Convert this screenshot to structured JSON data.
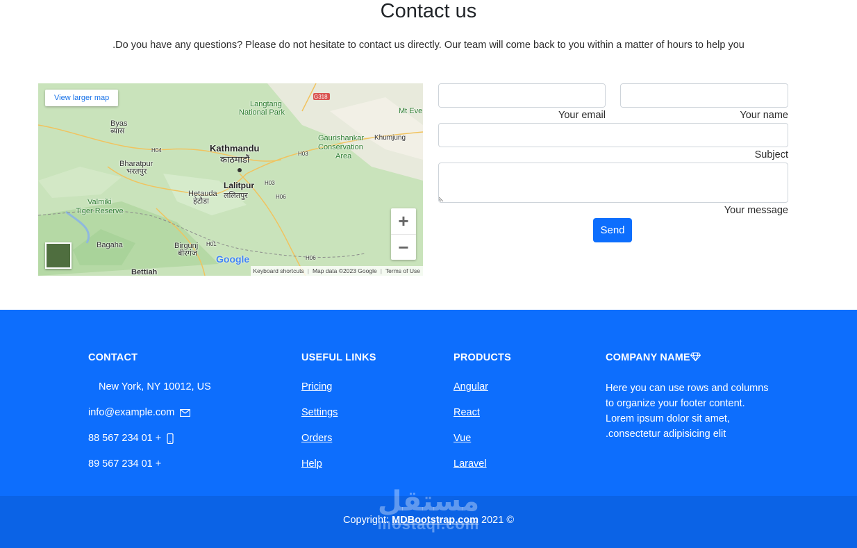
{
  "header": {
    "title": "Contact us",
    "subtitle": ".Do you have any questions? Please do not hesitate to contact us directly. Our team will come back to you within a matter of hours to help you"
  },
  "map": {
    "view_larger_label": "View larger map",
    "labels": {
      "kathmandu": "Kathmandu",
      "kathmandu_ne": "काठमाडौं",
      "lalitpur": "Lalitpur",
      "lalitpur_ne": "ललितपुर",
      "langtang": "Langtang",
      "national_park": "National Park",
      "gaurishankar": "Gaurishankar",
      "conservation": "Conservation",
      "area": "Area",
      "byas": "Byas",
      "byas_ne": "ब्यास",
      "bharatpur": "Bharatpur",
      "bharatpur_ne": "भरतपुर",
      "hetauda": "Hetauda",
      "hetauda_ne": "हेटौडा",
      "valmiki": "Valmiki",
      "tiger_reserve": "Tiger Reserve",
      "bagaha": "Bagaha",
      "birgunj": "Birgunj",
      "birgunj_ne": "बीरगंज",
      "bettiah": "Bettiah",
      "khumjung": "Khumjung",
      "mt_everest": "Mt Eve",
      "g318": "G318",
      "h04": "H04",
      "h03": "H03",
      "h03b": "H03",
      "h06": "H06",
      "h01": "H01",
      "h06b": "H06"
    },
    "zoom_in": "+",
    "zoom_out": "−",
    "google": "Google",
    "attribution": [
      "Keyboard shortcuts",
      "Map data ©2023 Google",
      "Terms of Use"
    ]
  },
  "form": {
    "email_label": "Your email",
    "name_label": "Your name",
    "subject_label": "Subject",
    "message_label": "Your message",
    "send_label": "Send"
  },
  "footer": {
    "contact": {
      "heading": "CONTACT",
      "address": "New York, NY 10012, US",
      "email": "info@example.com",
      "phone1": "88 567 234 01 +",
      "phone2": "89 567 234 01 +"
    },
    "useful_links": {
      "heading": "USEFUL LINKS",
      "items": [
        "Pricing",
        "Settings",
        "Orders",
        "Help"
      ]
    },
    "products": {
      "heading": "PRODUCTS",
      "items": [
        "Angular",
        "React",
        "Vue",
        "Laravel"
      ]
    },
    "company": {
      "heading": "COMPANY NAME",
      "text": "Here you can use rows and columns to organize your footer content. Lorem ipsum dolor sit amet, .consectetur adipisicing elit"
    },
    "copyright_prefix": "Copyright: ",
    "copyright_link": "MDBootstrap.com",
    "copyright_suffix": " 2021 ©",
    "watermark_ar": "مستقل",
    "watermark_lat": "mostaql.com"
  },
  "colors": {
    "primary": "#0d6efd",
    "footer_bottom": "#0b63e6"
  }
}
